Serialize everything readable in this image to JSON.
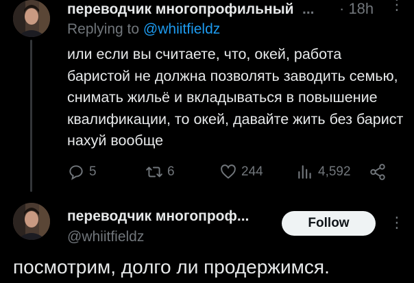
{
  "tweet1": {
    "author_name": "переводчик многопрофильный",
    "name_ellipsis": "...",
    "time": "· 18h",
    "more_glyph": "⋮",
    "reply_prefix": "Replying to ",
    "reply_handle": "@whiitfieldz",
    "text": "или если вы считаете, что, окей, работа баристой не должна позволять заводить семью, снимать жильё и вкладываться в повышение квалификации, то окей, давайте жить без барист нахуй вообще",
    "actions": {
      "replies": "5",
      "retweets": "6",
      "likes": "244",
      "views": "4,592"
    }
  },
  "tweet2": {
    "author_name": "переводчик многопроф...",
    "handle": "@whiitfieldz",
    "follow_label": "Follow",
    "more_glyph": "⋮",
    "text": "посмотрим, долго ли продержимся."
  },
  "colors": {
    "background": "#000000",
    "text": "#e7e9ea",
    "muted": "#71767b",
    "link": "#1d9bf0",
    "button_bg": "#eff3f4"
  },
  "icons": [
    "reply-icon",
    "retweet-icon",
    "like-icon",
    "views-icon",
    "share-icon",
    "more-icon"
  ]
}
